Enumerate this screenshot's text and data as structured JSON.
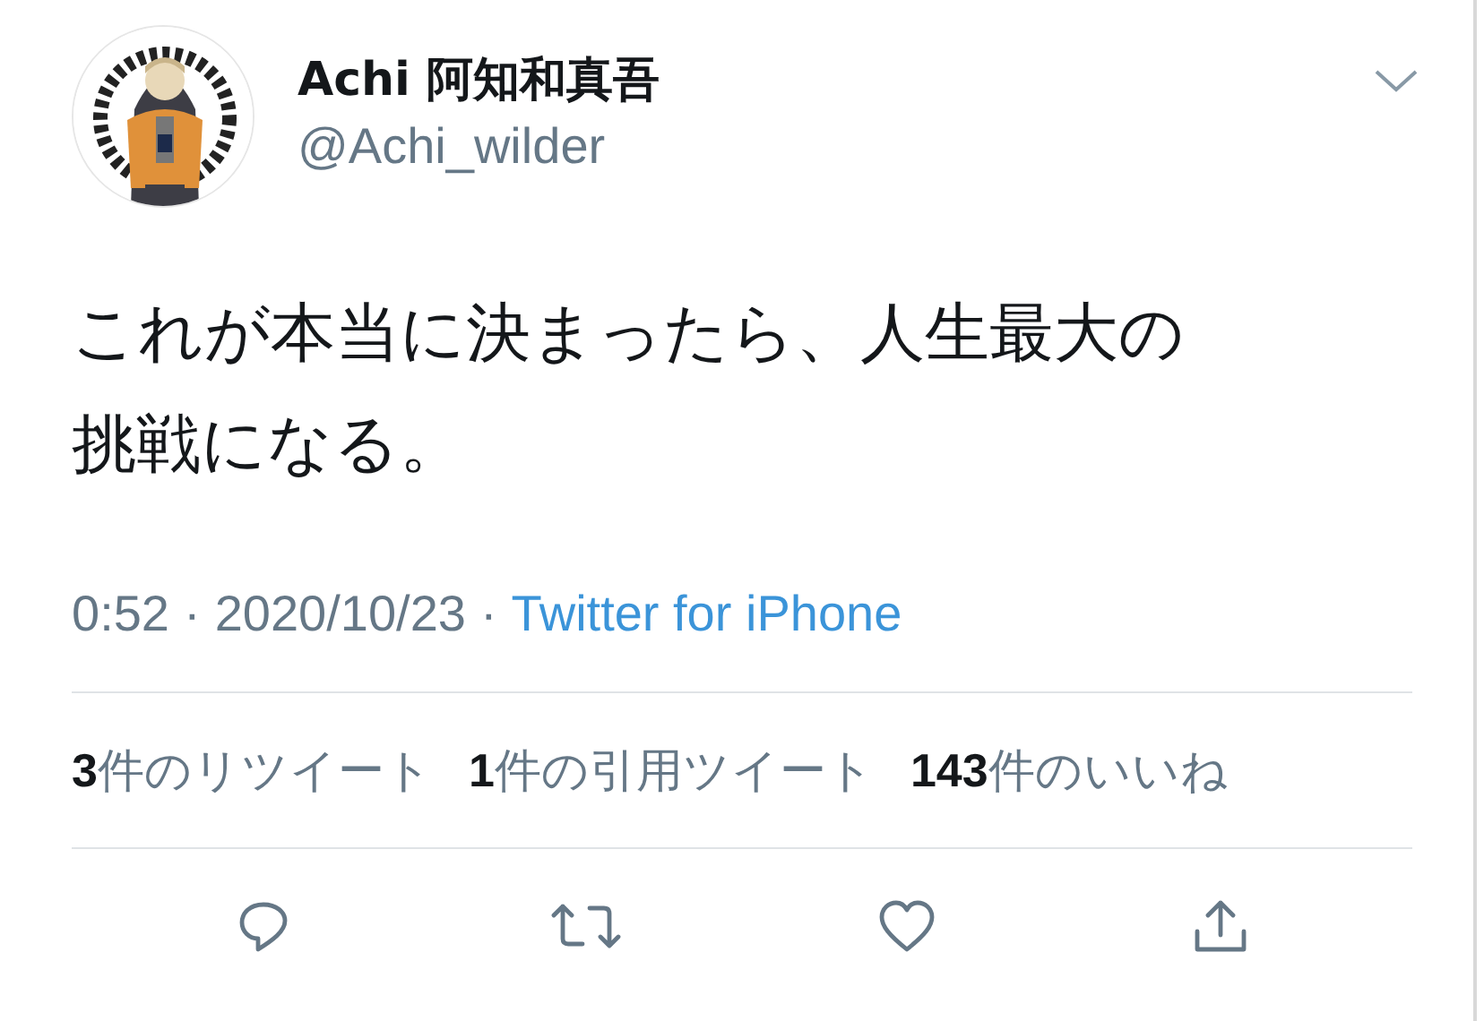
{
  "author": {
    "name": "Achi 阿知和真吾",
    "handle": "@Achi_wilder"
  },
  "tweet": {
    "text_lines": [
      "これが本当に決まったら、人生最大の",
      "挑戦になる。"
    ]
  },
  "meta": {
    "time": "0:52",
    "separator_1": "·",
    "date": "2020/10/23",
    "separator_2": "·",
    "source": "Twitter for iPhone"
  },
  "stats": [
    "**3**件のリツイート",
    "**1**件の引用ツイート",
    "**143**件のいいね"
  ],
  "actions": [
    {
      "kind": "reply"
    },
    {
      "kind": "retweet"
    },
    {
      "kind": "like"
    },
    {
      "kind": "share"
    }
  ]
}
